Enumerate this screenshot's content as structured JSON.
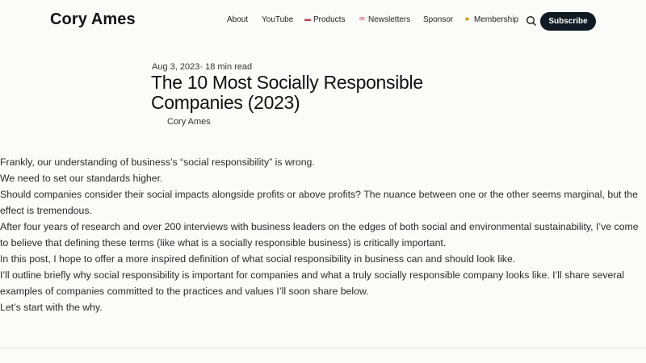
{
  "site": {
    "title": "Cory Ames"
  },
  "nav": {
    "items": [
      {
        "label": "About",
        "icon": ""
      },
      {
        "label": "YouTube",
        "icon": ""
      },
      {
        "label": "Products",
        "icon": "books-emoji-icon"
      },
      {
        "label": "Newsletters",
        "icon": "envelope-emoji-icon"
      },
      {
        "label": "Sponsor",
        "icon": ""
      },
      {
        "label": "Membership",
        "icon": "gift-emoji-icon"
      }
    ],
    "search_icon": "search-icon",
    "subscribe_label": "Subscribe"
  },
  "article": {
    "date": "Aug 3, 2023",
    "read_time": "18 min read",
    "separator": "·",
    "title": "The 10 Most Socially Responsible Companies (2023)",
    "author": "Cory Ames",
    "paragraphs": [
      "Frankly, our understanding of business’s  “social responsibility” is wrong.",
      "We need to set our standards higher.",
      "Should companies consider their social impacts alongside profits or above profits? The nuance between one or the other seems marginal, but the effect is tremendous.",
      "After four years of research and over 200 interviews with business leaders on the edges of both social and environmental sustainability, I’ve come to believe that defining these terms (like what is a socially responsible business) is critically important.",
      "In this post, I hope to offer a more inspired definition of what social responsibility in business can and should look like.",
      "I’ll outline briefly why social responsibility is important for companies and what a truly socially responsible company looks like. I’ll share several examples of companies committed to the practices and values I’ll soon share below.",
      "Let’s start with the why."
    ]
  },
  "colors": {
    "background": "#fbfbfa",
    "subscribe_bg": "#0f1a22",
    "subscribe_text": "#ffffff"
  }
}
